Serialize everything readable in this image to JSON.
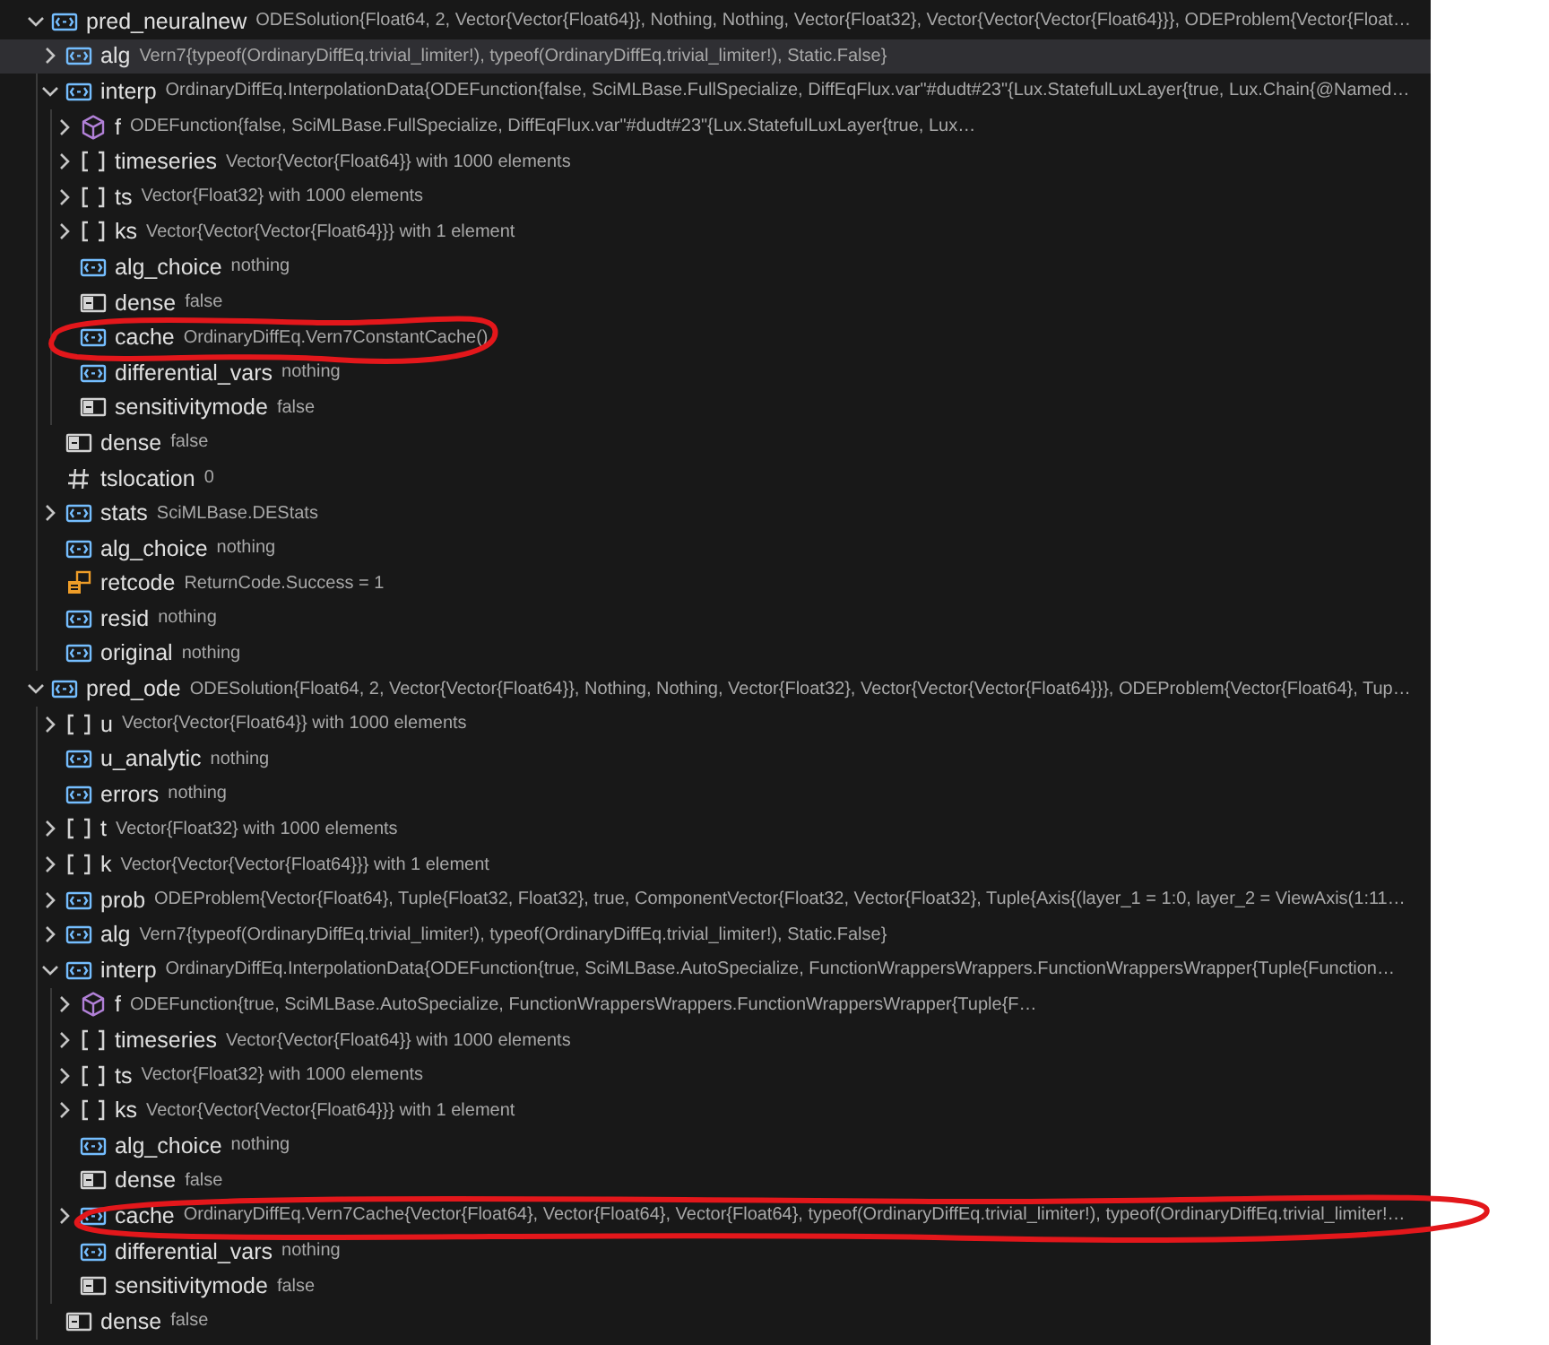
{
  "variables": [
    {
      "name": "pred_neuralnew",
      "value": "ODESolution{Float64, 2, Vector{Vector{Float64}}, Nothing, Nothing, Vector{Float32}, Vector{Vector{Vector{Float64}}}, ODEProblem{Vector{Float…",
      "kind": "variable",
      "expanded": true,
      "selected": false,
      "circled": false,
      "children": [
        {
          "name": "alg",
          "value": "Vern7{typeof(OrdinaryDiffEq.trivial_limiter!), typeof(OrdinaryDiffEq.trivial_limiter!), Static.False}",
          "kind": "variable",
          "expanded": false,
          "selected": true,
          "circled": false
        },
        {
          "name": "interp",
          "value": "OrdinaryDiffEq.InterpolationData{ODEFunction{false, SciMLBase.FullSpecialize, DiffEqFlux.var\"#dudt#23\"{Lux.StatefulLuxLayer{true, Lux.Chain{@Named…",
          "kind": "variable",
          "expanded": true,
          "selected": false,
          "circled": false,
          "children": [
            {
              "name": "f",
              "value": "ODEFunction{false, SciMLBase.FullSpecialize, DiffEqFlux.var\"#dudt#23\"{Lux.StatefulLuxLayer{true, Lux…",
              "kind": "object",
              "expanded": false,
              "selected": false,
              "circled": false
            },
            {
              "name": "timeseries",
              "value": "Vector{Vector{Float64}} with 1000 elements",
              "kind": "array",
              "expanded": false,
              "selected": false,
              "circled": false
            },
            {
              "name": "ts",
              "value": "Vector{Float32} with 1000 elements",
              "kind": "array",
              "expanded": false,
              "selected": false,
              "circled": false
            },
            {
              "name": "ks",
              "value": "Vector{Vector{Vector{Float64}}} with 1 element",
              "kind": "array",
              "expanded": false,
              "selected": false,
              "circled": false
            },
            {
              "name": "alg_choice",
              "value": "nothing",
              "kind": "variable",
              "selected": false,
              "circled": false
            },
            {
              "name": "dense",
              "value": "false",
              "kind": "boolean",
              "selected": false,
              "circled": false
            },
            {
              "name": "cache",
              "value": "OrdinaryDiffEq.Vern7ConstantCache()",
              "kind": "variable",
              "selected": false,
              "circled": true
            },
            {
              "name": "differential_vars",
              "value": "nothing",
              "kind": "variable",
              "selected": false,
              "circled": false
            },
            {
              "name": "sensitivitymode",
              "value": "false",
              "kind": "boolean",
              "selected": false,
              "circled": false
            }
          ]
        },
        {
          "name": "dense",
          "value": "false",
          "kind": "boolean",
          "selected": false,
          "circled": false
        },
        {
          "name": "tslocation",
          "value": "0",
          "kind": "number",
          "selected": false,
          "circled": false
        },
        {
          "name": "stats",
          "value": "SciMLBase.DEStats",
          "kind": "variable",
          "expanded": false,
          "selected": false,
          "circled": false
        },
        {
          "name": "alg_choice",
          "value": "nothing",
          "kind": "variable",
          "selected": false,
          "circled": false
        },
        {
          "name": "retcode",
          "value": "ReturnCode.Success = 1",
          "kind": "enum",
          "selected": false,
          "circled": false
        },
        {
          "name": "resid",
          "value": "nothing",
          "kind": "variable",
          "selected": false,
          "circled": false
        },
        {
          "name": "original",
          "value": "nothing",
          "kind": "variable",
          "selected": false,
          "circled": false
        }
      ]
    },
    {
      "name": "pred_ode",
      "value": "ODESolution{Float64, 2, Vector{Vector{Float64}}, Nothing, Nothing, Vector{Float32}, Vector{Vector{Vector{Float64}}}, ODEProblem{Vector{Float64}, Tup…",
      "kind": "variable",
      "expanded": true,
      "selected": false,
      "circled": false,
      "children": [
        {
          "name": "u",
          "value": "Vector{Vector{Float64}} with 1000 elements",
          "kind": "array",
          "expanded": false,
          "selected": false,
          "circled": false
        },
        {
          "name": "u_analytic",
          "value": "nothing",
          "kind": "variable",
          "selected": false,
          "circled": false
        },
        {
          "name": "errors",
          "value": "nothing",
          "kind": "variable",
          "selected": false,
          "circled": false
        },
        {
          "name": "t",
          "value": "Vector{Float32} with 1000 elements",
          "kind": "array",
          "expanded": false,
          "selected": false,
          "circled": false
        },
        {
          "name": "k",
          "value": "Vector{Vector{Vector{Float64}}} with 1 element",
          "kind": "array",
          "expanded": false,
          "selected": false,
          "circled": false
        },
        {
          "name": "prob",
          "value": "ODEProblem{Vector{Float64}, Tuple{Float32, Float32}, true, ComponentVector{Float32, Vector{Float32}, Tuple{Axis{(layer_1 = 1:0, layer_2 = ViewAxis(1:11…",
          "kind": "variable",
          "expanded": false,
          "selected": false,
          "circled": false
        },
        {
          "name": "alg",
          "value": "Vern7{typeof(OrdinaryDiffEq.trivial_limiter!), typeof(OrdinaryDiffEq.trivial_limiter!), Static.False}",
          "kind": "variable",
          "expanded": false,
          "selected": false,
          "circled": false
        },
        {
          "name": "interp",
          "value": "OrdinaryDiffEq.InterpolationData{ODEFunction{true, SciMLBase.AutoSpecialize, FunctionWrappersWrappers.FunctionWrappersWrapper{Tuple{Function…",
          "kind": "variable",
          "expanded": true,
          "selected": false,
          "circled": false,
          "children": [
            {
              "name": "f",
              "value": "ODEFunction{true, SciMLBase.AutoSpecialize, FunctionWrappersWrappers.FunctionWrappersWrapper{Tuple{F…",
              "kind": "object",
              "expanded": false,
              "selected": false,
              "circled": false
            },
            {
              "name": "timeseries",
              "value": "Vector{Vector{Float64}} with 1000 elements",
              "kind": "array",
              "expanded": false,
              "selected": false,
              "circled": false
            },
            {
              "name": "ts",
              "value": "Vector{Float32} with 1000 elements",
              "kind": "array",
              "expanded": false,
              "selected": false,
              "circled": false
            },
            {
              "name": "ks",
              "value": "Vector{Vector{Vector{Float64}}} with 1 element",
              "kind": "array",
              "expanded": false,
              "selected": false,
              "circled": false
            },
            {
              "name": "alg_choice",
              "value": "nothing",
              "kind": "variable",
              "selected": false,
              "circled": false
            },
            {
              "name": "dense",
              "value": "false",
              "kind": "boolean",
              "selected": false,
              "circled": false
            },
            {
              "name": "cache",
              "value": "OrdinaryDiffEq.Vern7Cache{Vector{Float64}, Vector{Float64}, Vector{Float64}, typeof(OrdinaryDiffEq.trivial_limiter!), typeof(OrdinaryDiffEq.trivial_limiter!…",
              "kind": "variable",
              "expanded": false,
              "selected": false,
              "circled": true
            },
            {
              "name": "differential_vars",
              "value": "nothing",
              "kind": "variable",
              "selected": false,
              "circled": false
            },
            {
              "name": "sensitivitymode",
              "value": "false",
              "kind": "boolean",
              "selected": false,
              "circled": false
            }
          ]
        },
        {
          "name": "dense",
          "value": "false",
          "kind": "boolean",
          "selected": false,
          "circled": false
        }
      ]
    }
  ]
}
